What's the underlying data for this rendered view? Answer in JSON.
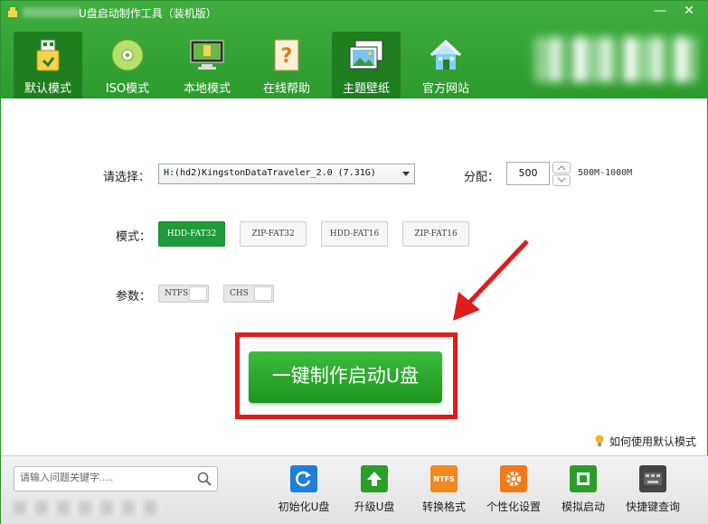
{
  "window": {
    "title": "U盘启动制作工具（装机版）",
    "controls": {
      "minimize": "—",
      "close": "✕"
    }
  },
  "nav": {
    "tabs": [
      {
        "label": "默认模式",
        "icon": "usb-drive-icon",
        "active": true
      },
      {
        "label": "ISO模式",
        "icon": "disc-icon",
        "active": false
      },
      {
        "label": "本地模式",
        "icon": "monitor-icon",
        "active": false
      },
      {
        "label": "在线帮助",
        "icon": "help-book-icon",
        "active": false
      },
      {
        "label": "主题壁纸",
        "icon": "wallpaper-icon",
        "active": false
      },
      {
        "label": "官方网站",
        "icon": "home-icon",
        "active": false
      }
    ]
  },
  "form": {
    "device_label": "请选择：",
    "device_value": "H:(hd2)KingstonDataTraveler_2.0 (7.31G)",
    "alloc_label": "分配：",
    "alloc_value": "500",
    "alloc_range": "500M-1000M",
    "mode_label": "模式：",
    "modes": [
      {
        "label": "HDD-FAT32",
        "active": true
      },
      {
        "label": "ZIP-FAT32",
        "active": false
      },
      {
        "label": "HDD-FAT16",
        "active": false
      },
      {
        "label": "ZIP-FAT16",
        "active": false
      }
    ],
    "param_label": "参数：",
    "params": [
      {
        "label": "NTFS"
      },
      {
        "label": "CHS"
      }
    ],
    "make_button": "一键制作启动U盘"
  },
  "help_link": "如何使用默认模式",
  "footer": {
    "search_placeholder": "请输入问题关键字.....",
    "tools": [
      {
        "label": "初始化U盘",
        "icon": "refresh-icon",
        "color": "#1e7fd8"
      },
      {
        "label": "升级U盘",
        "icon": "upload-arrow-icon",
        "color": "#2a9e2a"
      },
      {
        "label": "转换格式",
        "icon": "ntfs-icon",
        "color": "#f08a1e",
        "icon_text": "NTFS"
      },
      {
        "label": "个性化设置",
        "icon": "gear-icon",
        "color": "#f07a1a"
      },
      {
        "label": "模拟启动",
        "icon": "simulate-icon",
        "color": "#2a9e2a"
      },
      {
        "label": "快捷键查询",
        "icon": "keyboard-icon",
        "color": "#444444"
      }
    ]
  },
  "colors": {
    "header_green": "#2c9a2c",
    "active_tab": "#1f7e1f",
    "highlight_red": "#e01c1c",
    "button_green": "#1e951e"
  }
}
